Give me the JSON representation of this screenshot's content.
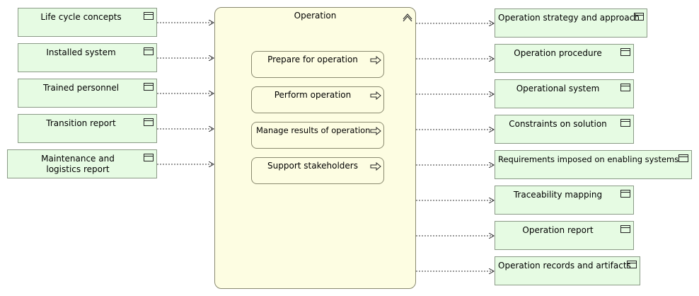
{
  "process": {
    "title": "Operation",
    "activities": [
      "Prepare for operation",
      "Perform operation",
      "Manage results of operation",
      "Support stakeholders"
    ]
  },
  "inputs": [
    "Life cycle concepts",
    "Installed system",
    "Trained personnel",
    "Transition report",
    "Maintenance and logistics report"
  ],
  "outputs": [
    "Operation strategy and approach",
    "Operation procedure",
    "Operational system",
    "Constraints on solution",
    "Requirements imposed on enabling systems",
    "Traceability mapping",
    "Operation report",
    "Operation records and artifacts"
  ],
  "colors": {
    "artifact_fill": "#e6fbe3",
    "process_fill": "#fdfde2",
    "connector": "#333333"
  },
  "icons": {
    "artifact": "data-object-icon",
    "activity": "process-arrow-icon",
    "collapse": "collapse-caret-icon"
  }
}
